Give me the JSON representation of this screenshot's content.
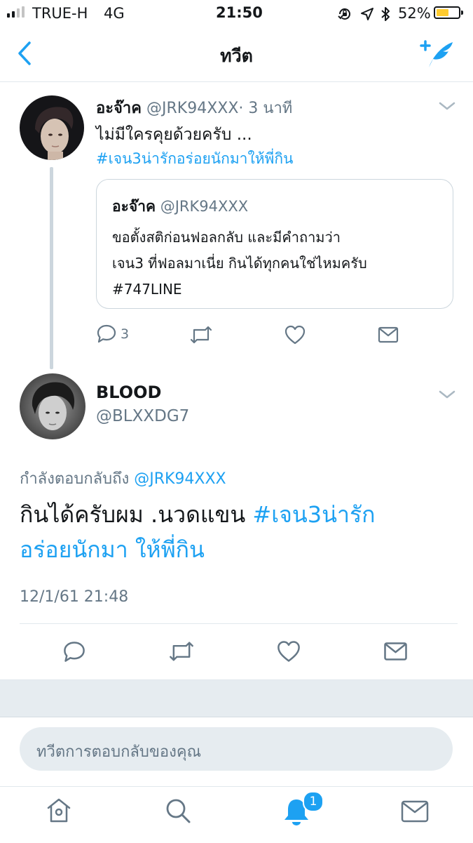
{
  "status_bar": {
    "carrier": "TRUE-H",
    "network": "4G",
    "time": "21:50",
    "battery_percent": "52%",
    "battery_level": 0.52,
    "signal_bars_active": 2,
    "icons": [
      "rotation-lock-icon",
      "location-icon",
      "bluetooth-icon",
      "battery-icon"
    ]
  },
  "nav": {
    "title": "ทวีต",
    "back_icon": "back-chevron-icon",
    "compose_icon": "compose-tweet-icon",
    "accent": "#1da1f2"
  },
  "parent_tweet": {
    "display_name": "อะจ๊าค",
    "handle": "@JRK94XXX",
    "separator": "·",
    "time_ago": "3 นาที",
    "text": "ไม่มีใครคุยด้วยครับ ...",
    "hashtag": "#เจน3น่ารักอร่อยนักมาให้พี่กิน",
    "quote": {
      "display_name": "อะจ๊าค",
      "handle": "@JRK94XXX",
      "line1": "ขอตั้งสติก่อนฟอลกลับ และมีคำถามว่า",
      "line2": "เจน3 ที่ฟอลมาเนี่ย กินได้ทุกคนใช่ไหมครับ",
      "line3": "#747LINE"
    },
    "reply_count": "3"
  },
  "main_tweet": {
    "display_name": "BLOOD",
    "handle": "@BLXXDG7",
    "replying_to_label": "กำลังตอบกลับถึง",
    "replying_to_handle": "@JRK94XXX",
    "text_plain": "กินได้ครับผม .นวดแขน",
    "hashtag_line1": "#เจน3น่ารัก",
    "hashtag_line2": "อร่อยนักมา ให้พี่กิน",
    "timestamp": "12/1/61 21:48"
  },
  "reply_box": {
    "placeholder": "ทวีตการตอบกลับของคุณ"
  },
  "tab_bar": {
    "items": [
      "home-icon",
      "search-icon",
      "notifications-icon",
      "messages-icon"
    ],
    "notification_badge": "1"
  }
}
